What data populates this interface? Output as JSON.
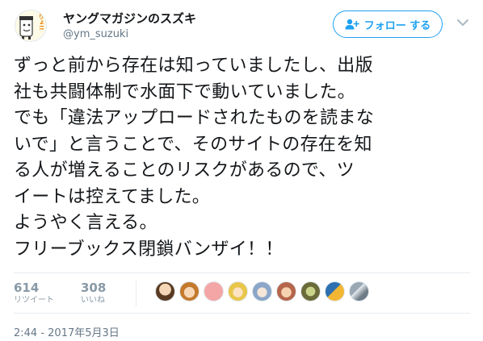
{
  "user": {
    "display_name": "ヤングマガジンのスズキ",
    "screen_name": "@ym_suzuki",
    "avatar_text": "りょ!!"
  },
  "follow_button": {
    "label": "フォロー する",
    "icon": "add-user-icon",
    "color": "#1da1f2"
  },
  "caret_icon": "chevron-down-icon",
  "tweet": {
    "lines": [
      "ずっと前から存在は知っていましたし、出版",
      "社も共闘体制で水面下で動いていました。",
      "でも「違法アップロードされたものを読まな",
      "いで」と言うことで、そのサイトの存在を知",
      "る人が増えることのリスクがあるので、ツ",
      "イートは控えてました。",
      "ようやく言える。",
      "フリーブックス閉鎖バンザイ！！"
    ]
  },
  "stats": {
    "retweets": {
      "value": "614",
      "label": "リツイート"
    },
    "likes": {
      "value": "308",
      "label": "いいね"
    }
  },
  "likers": [
    "liker-avatar-1",
    "liker-avatar-2",
    "liker-avatar-3",
    "liker-avatar-4",
    "liker-avatar-5",
    "liker-avatar-6",
    "liker-avatar-7",
    "liker-avatar-8",
    "liker-avatar-9"
  ],
  "timestamp": "2:44 - 2017年5月3日"
}
